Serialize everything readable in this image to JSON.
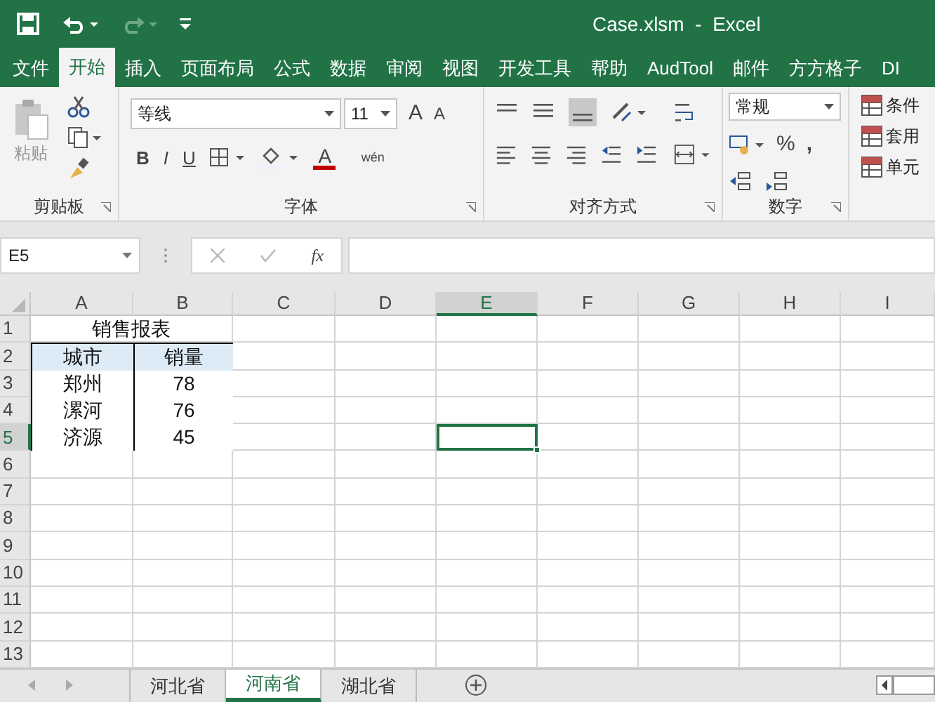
{
  "title_bar": {
    "title": "Case.xlsm  -  Excel"
  },
  "ribbon_tabs": [
    {
      "label": "文件",
      "selected": false
    },
    {
      "label": "开始",
      "selected": true
    },
    {
      "label": "插入",
      "selected": false
    },
    {
      "label": "页面布局",
      "selected": false
    },
    {
      "label": "公式",
      "selected": false
    },
    {
      "label": "数据",
      "selected": false
    },
    {
      "label": "审阅",
      "selected": false
    },
    {
      "label": "视图",
      "selected": false
    },
    {
      "label": "开发工具",
      "selected": false
    },
    {
      "label": "帮助",
      "selected": false
    },
    {
      "label": "AudTool",
      "selected": false
    },
    {
      "label": "邮件",
      "selected": false
    },
    {
      "label": "方方格子",
      "selected": false
    },
    {
      "label": "DI",
      "selected": false
    }
  ],
  "clipboard": {
    "paste": "粘贴",
    "label": "剪贴板"
  },
  "font": {
    "name": "等线",
    "size": "11",
    "grow": "A",
    "shrink": "A",
    "styles": [
      "B",
      "I",
      "U"
    ],
    "color_letter": "A",
    "phonetic": "wén",
    "label": "字体"
  },
  "alignment": {
    "label": "对齐方式"
  },
  "number": {
    "format": "常规",
    "percent": "%",
    "comma": ",",
    "label": "数字"
  },
  "styles": {
    "items": [
      "条件",
      "套用",
      "单元"
    ]
  },
  "formula_bar": {
    "name_box": "E5",
    "fx": "fx"
  },
  "columns": [
    {
      "label": "A",
      "selected": false
    },
    {
      "label": "B",
      "selected": false
    },
    {
      "label": "C",
      "selected": false
    },
    {
      "label": "D",
      "selected": false
    },
    {
      "label": "E",
      "selected": true
    },
    {
      "label": "F",
      "selected": false
    },
    {
      "label": "G",
      "selected": false
    },
    {
      "label": "H",
      "selected": false
    },
    {
      "label": "I",
      "selected": false
    }
  ],
  "rows": [
    {
      "number": "1",
      "selected": false,
      "cells": [
        {
          "kind": "merged",
          "text": "销售报表"
        }
      ]
    },
    {
      "number": "2",
      "selected": false,
      "cells": [
        {
          "kind": "header",
          "text": "城市"
        },
        {
          "kind": "header",
          "text": "销量"
        }
      ]
    },
    {
      "number": "3",
      "selected": false,
      "cells": [
        {
          "kind": "data",
          "text": "郑州"
        },
        {
          "kind": "data",
          "text": "78"
        }
      ]
    },
    {
      "number": "4",
      "selected": false,
      "cells": [
        {
          "kind": "data",
          "text": "漯河"
        },
        {
          "kind": "data",
          "text": "76"
        }
      ]
    },
    {
      "number": "5",
      "selected": true,
      "cells": [
        {
          "kind": "data",
          "text": "济源"
        },
        {
          "kind": "data",
          "text": "45"
        }
      ]
    },
    {
      "number": "6",
      "selected": false,
      "cells": []
    },
    {
      "number": "7",
      "selected": false,
      "cells": []
    },
    {
      "number": "8",
      "selected": false,
      "cells": []
    },
    {
      "number": "9",
      "selected": false,
      "cells": []
    },
    {
      "number": "10",
      "selected": false,
      "cells": []
    },
    {
      "number": "11",
      "selected": false,
      "cells": []
    },
    {
      "number": "12",
      "selected": false,
      "cells": []
    },
    {
      "number": "13",
      "selected": false,
      "cells": []
    }
  ],
  "sheet_tabs": [
    {
      "label": "河北省",
      "selected": false
    },
    {
      "label": "河南省",
      "selected": true
    },
    {
      "label": "湖北省",
      "selected": false
    }
  ]
}
